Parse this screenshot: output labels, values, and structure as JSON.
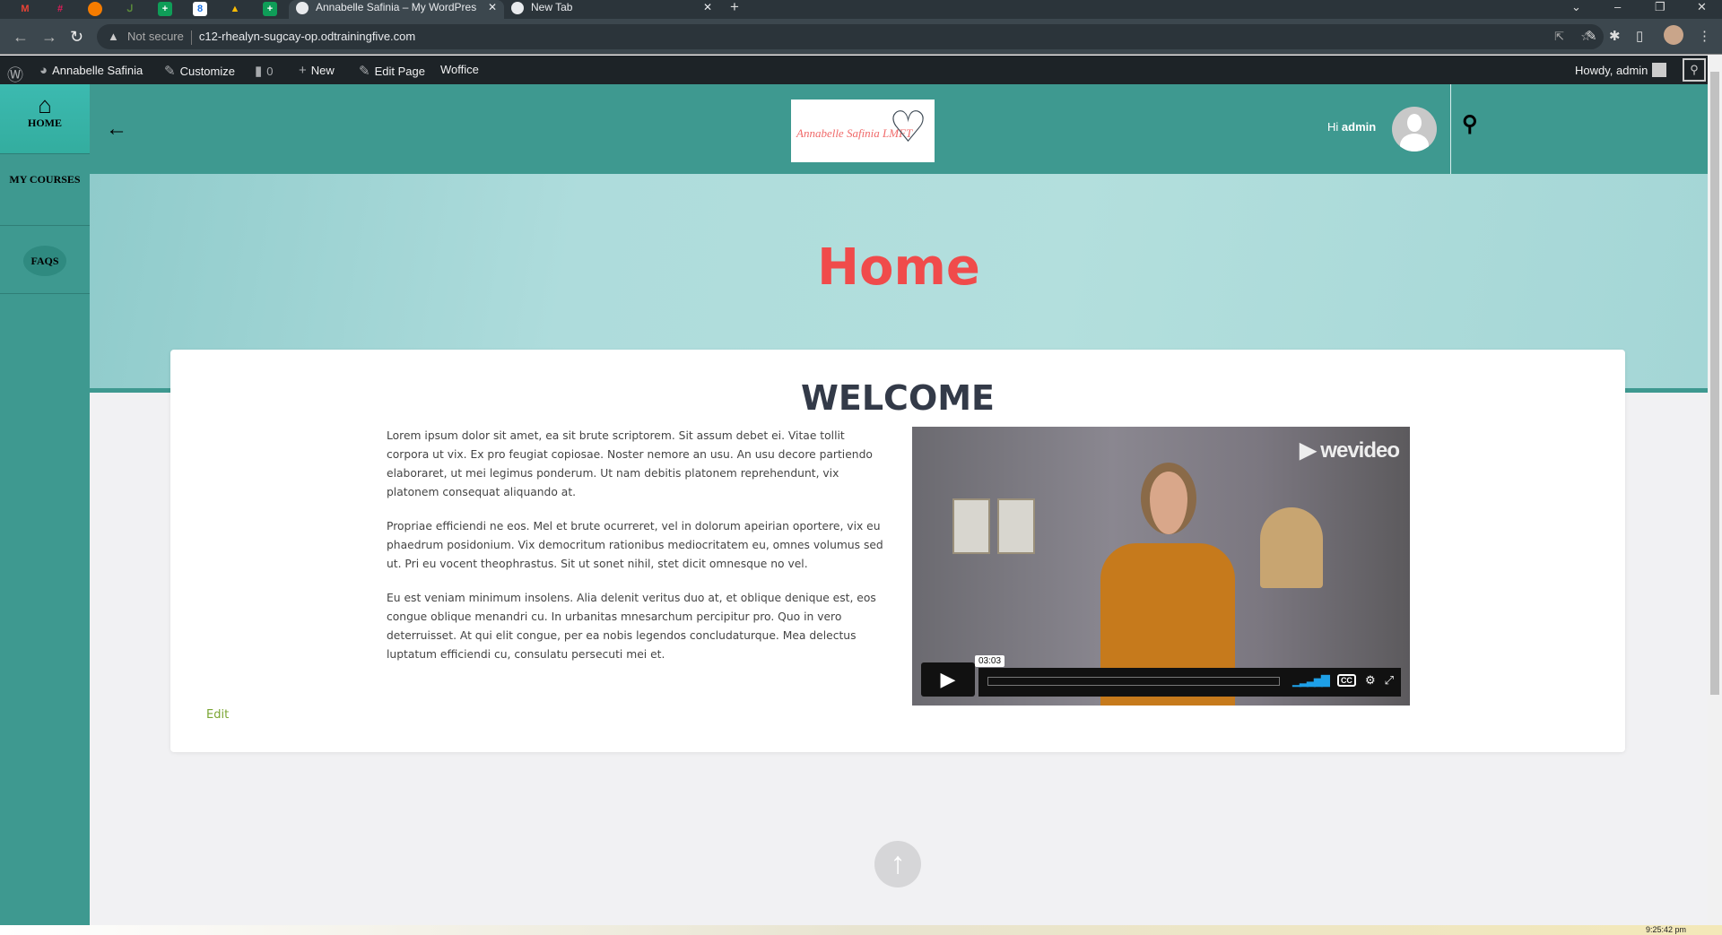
{
  "browser": {
    "tabs": [
      {
        "title": "Annabelle Safinia – My WordPres",
        "active": true
      },
      {
        "title": "New Tab",
        "active": false
      }
    ],
    "pinned_tabs": [
      "gmail",
      "slack",
      "app",
      "app",
      "sheets",
      "app",
      "drive",
      "sheets"
    ],
    "security": "Not secure",
    "url": "c12-rhealyn-sugcay-op.odtrainingfive.com"
  },
  "adminbar": {
    "site_name": "Annabelle Safinia",
    "customize": "Customize",
    "comments_count": "0",
    "new": "New",
    "edit_page": "Edit Page",
    "woffice": "Woffice",
    "howdy": "Howdy, admin"
  },
  "sidebar": {
    "items": [
      {
        "label": "HOME"
      },
      {
        "label": "MY COURSES"
      },
      {
        "label": "FAQS"
      }
    ]
  },
  "header": {
    "logo_text": "Annabelle Safinia LMFT",
    "greeting": "Hi",
    "username": "admin"
  },
  "hero": {
    "title": "Home"
  },
  "content": {
    "heading": "WELCOME",
    "paragraphs": [
      "Lorem ipsum dolor sit amet, ea sit brute scriptorem. Sit assum debet ei. Vitae tollit corpora ut vix. Ex pro feugiat copiosae. Noster nemore an usu. An usu decore partiendo elaboraret, ut mei legimus ponderum. Ut nam debitis platonem reprehendunt, vix platonem consequat aliquando at.",
      "Propriae efficiendi ne eos. Mel et brute ocurreret, vel in dolorum apeirian oportere, vix eu phaedrum posidonium. Vix democritum rationibus mediocritatem eu, omnes volumus sed ut. Pri eu vocent theophrastus. Sit ut sonet nihil, stet dicit omnesque no vel.",
      "Eu est veniam minimum insolens. Alia delenit veritus duo at, et oblique denique est, eos congue oblique menandri cu. In urbanitas mnesarchum percipitur pro. Quo in vero deterruisset. At qui elit congue, per ea nobis legendos concludaturque. Mea delectus luptatum efficiendi cu, consulatu persecuti mei et."
    ],
    "edit_link": "Edit",
    "video": {
      "brand": "wevideo",
      "duration": "03:03",
      "cc": "CC",
      "progress": 0
    }
  },
  "taskbar": {
    "clock": "9:25:42 pm"
  },
  "colors": {
    "teal": "#3e9990",
    "hero_title": "#f04b4b",
    "adminbar": "#1d2327"
  }
}
